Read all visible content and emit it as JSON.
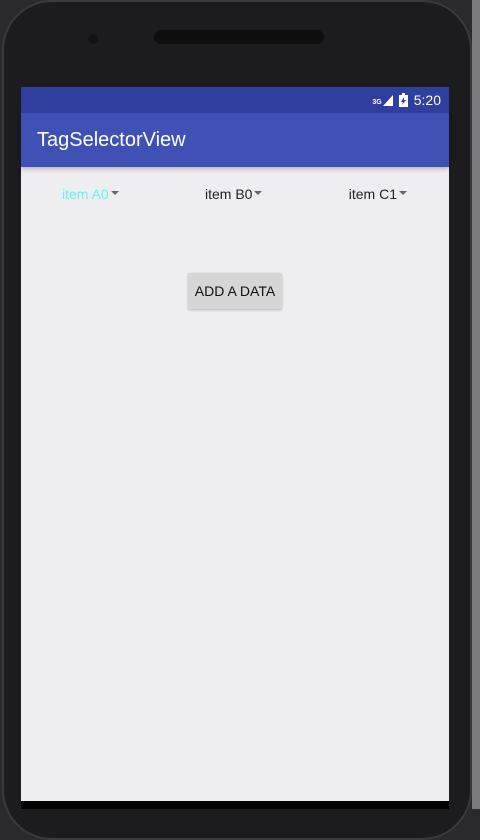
{
  "status_bar": {
    "network": "3G",
    "time": "5:20"
  },
  "app_bar": {
    "title": "TagSelectorView"
  },
  "tabs": [
    {
      "label": "item A0",
      "active": true
    },
    {
      "label": "item B0"
    },
    {
      "label": "item C1"
    }
  ],
  "add_button": {
    "label": "ADD A DATA"
  },
  "colors": {
    "status": "#303f9f",
    "primary": "#3f51b5",
    "active_tab": "#5ff5f0"
  }
}
